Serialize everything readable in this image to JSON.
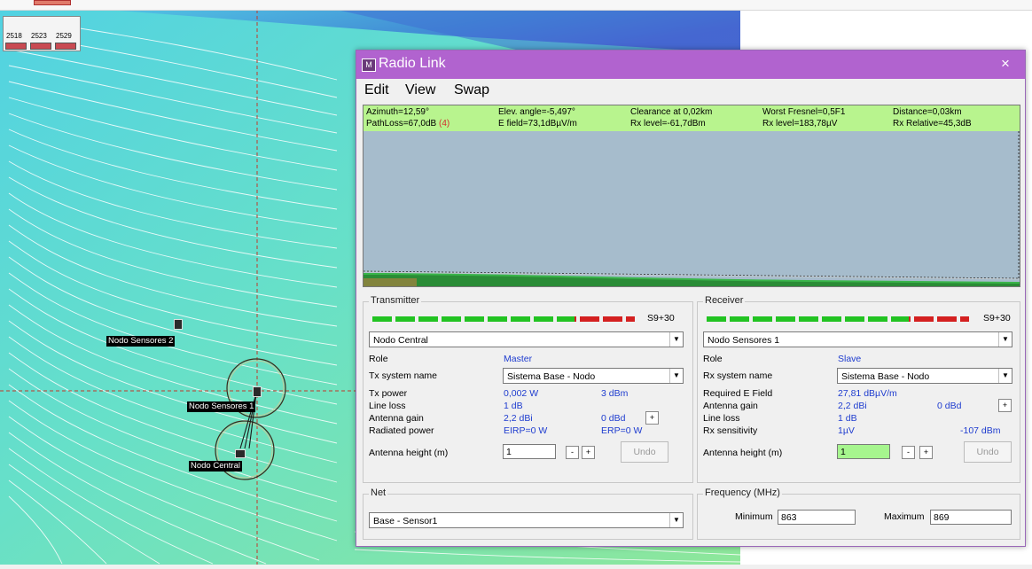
{
  "map": {
    "legend": {
      "labels": [
        "2518",
        "2523",
        "2529"
      ],
      "swatch_color": "#c94a52"
    },
    "nodes": {
      "sensores2": "Nodo Sensores 2",
      "sensores1": "Nodo Sensores 1",
      "central": "Nodo Central"
    }
  },
  "dialog": {
    "title": "Radio Link",
    "close_label": "×",
    "menu": {
      "edit": "Edit",
      "view": "View",
      "swap": "Swap"
    },
    "info": {
      "azimuth": "Azimuth=12,59°",
      "elev_angle": "Elev. angle=-5,497°",
      "clearance": "Clearance at 0,02km",
      "worst_fresnel": "Worst Fresnel=0,5F1",
      "distance": "Distance=0,03km",
      "path_loss": "PathLoss=67,0dB",
      "path_loss_code": "(4)",
      "e_field": "E field=73,1dBµV/m",
      "rx_level_dbm": "Rx level=-61,7dBm",
      "rx_level_uv": "Rx level=183,78µV",
      "rx_relative": "Rx Relative=45,3dB"
    },
    "transmitter": {
      "section_title": "Transmitter",
      "meter_label": "S9+30",
      "node": "Nodo Central",
      "role_label": "Role",
      "role_value": "Master",
      "system_label": "Tx system name",
      "system_value": "Sistema Base - Nodo",
      "power_label": "Tx power",
      "power_w": "0,002 W",
      "power_dbm": "3 dBm",
      "line_loss_label": "Line loss",
      "line_loss_value": "1 dB",
      "gain_label": "Antenna gain",
      "gain_dbi": "2,2 dBi",
      "gain_dbd": "0 dBd",
      "radiated_label": "Radiated power",
      "eirp": "EIRP=0 W",
      "erp": "ERP=0 W",
      "height_label": "Antenna height (m)",
      "height_value": "1",
      "minus_label": "-",
      "plus_label": "+",
      "undo_label": "Undo"
    },
    "receiver": {
      "section_title": "Receiver",
      "meter_label": "S9+30",
      "node": "Nodo Sensores 1",
      "role_label": "Role",
      "role_value": "Slave",
      "system_label": "Rx system name",
      "system_value": "Sistema Base - Nodo",
      "field_label": "Required E Field",
      "field_value": "27,81 dBµV/m",
      "gain_label": "Antenna gain",
      "gain_dbi": "2,2 dBi",
      "gain_dbd": "0 dBd",
      "line_loss_label": "Line loss",
      "line_loss_value": "1 dB",
      "sens_label": "Rx sensitivity",
      "sens_uv": "1µV",
      "sens_dbm": "-107 dBm",
      "height_label": "Antenna height (m)",
      "height_value": "1",
      "minus_label": "-",
      "plus_label": "+",
      "undo_label": "Undo"
    },
    "net": {
      "section_title": "Net",
      "value": "Base - Sensor1"
    },
    "frequency": {
      "section_title": "Frequency (MHz)",
      "min_label": "Minimum",
      "min_value": "863",
      "max_label": "Maximum",
      "max_value": "869"
    }
  },
  "colors": {
    "title_bar": "#b163cf",
    "info_bar": "#b8f48e",
    "meter_green": "#22c322",
    "meter_red": "#d42020",
    "highlight_input": "#a6f58e"
  }
}
